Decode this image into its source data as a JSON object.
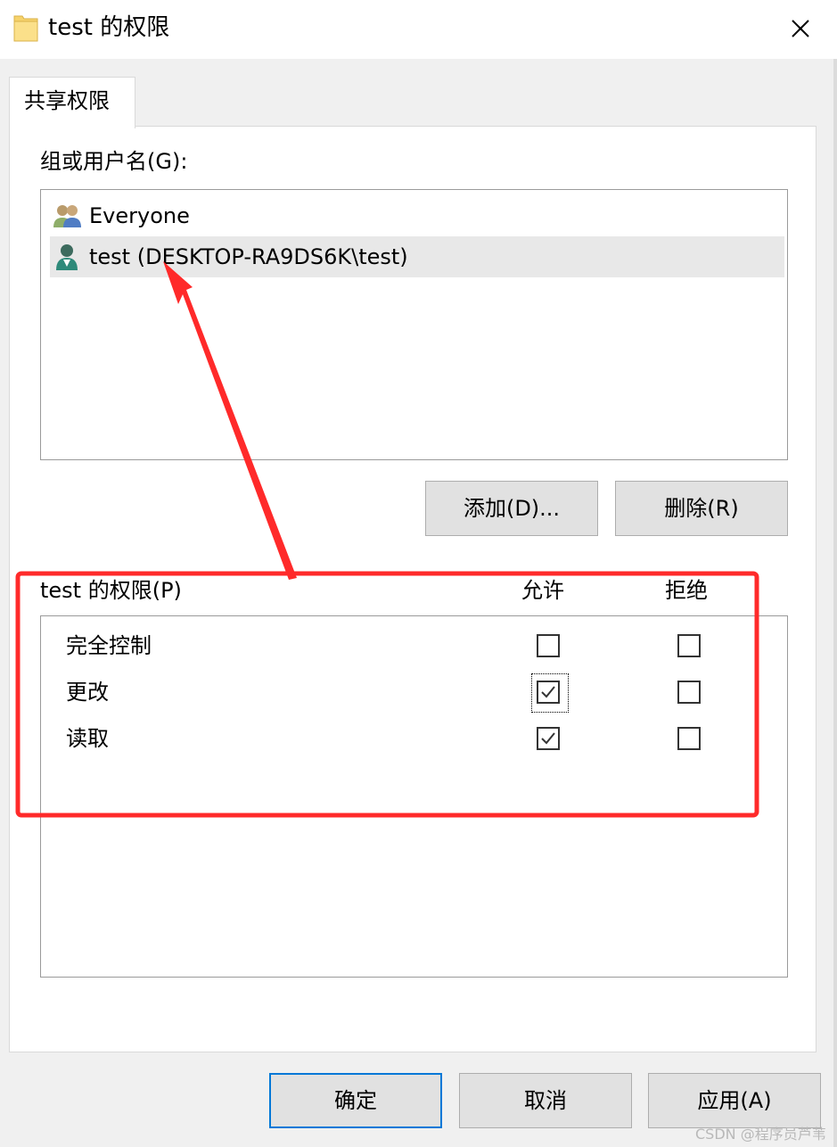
{
  "window": {
    "title": "test 的权限",
    "folder_icon": "folder-icon",
    "close_icon": "close-icon",
    "close_glyph": "✕"
  },
  "tab": {
    "label": "共享权限"
  },
  "group_list": {
    "label": "组或用户名(G):",
    "items": [
      {
        "name": "Everyone",
        "icon": "users-group-icon",
        "selected": false
      },
      {
        "name": "test (DESKTOP-RA9DS6K\\test)",
        "icon": "user-icon",
        "selected": true
      }
    ]
  },
  "buttons": {
    "add": "添加(D)...",
    "remove": "删除(R)",
    "ok": "确定",
    "cancel": "取消",
    "apply": "应用(A)"
  },
  "permissions": {
    "label": "test 的权限(P)",
    "allow_header": "允许",
    "deny_header": "拒绝",
    "rows": [
      {
        "name": "完全控制",
        "allow": false,
        "deny": false
      },
      {
        "name": "更改",
        "allow": true,
        "deny": false
      },
      {
        "name": "读取",
        "allow": true,
        "deny": false
      }
    ]
  },
  "annotation": {
    "color": "#ff2a2a"
  },
  "watermark": "CSDN @程序员芦苇"
}
